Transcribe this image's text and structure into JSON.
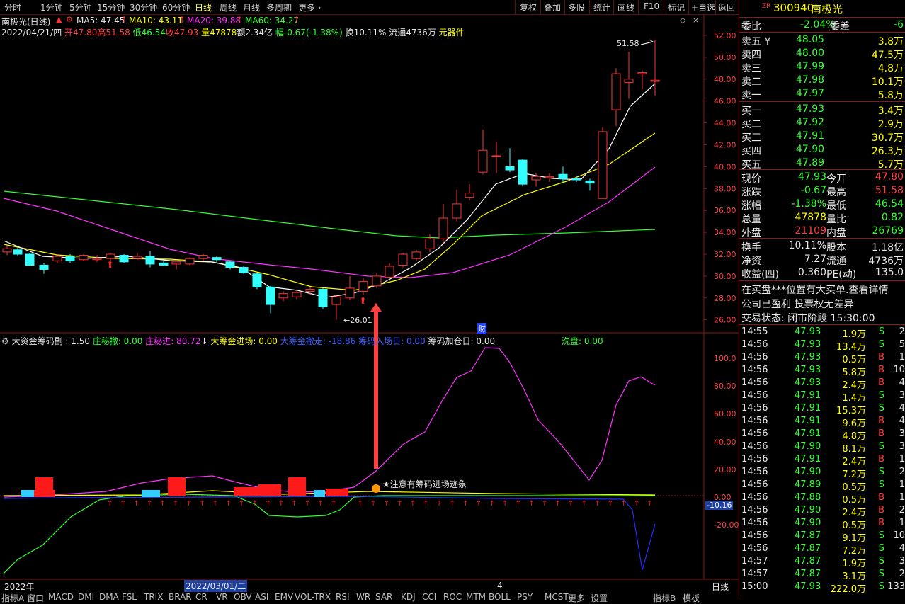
{
  "toolbar": {
    "periods": [
      "分时",
      "1分钟",
      "5分钟",
      "15分钟",
      "30分钟",
      "60分钟",
      "日线",
      "周线",
      "月线",
      "多周期",
      "更多"
    ],
    "active_period": "日线",
    "right_buttons": [
      "复权",
      "叠加",
      "多股",
      "统计",
      "画线",
      "F10",
      "标记",
      "+自选",
      "返回"
    ]
  },
  "indicator_line": {
    "name": "南极光(日线)",
    "ma5": "MA5: 47.45",
    "ma10": "MA10: 43.11",
    "ma20": "MA20: 39.88",
    "ma60": "MA60: 34.27"
  },
  "ohlc_line": {
    "date": "2022/04/21/四",
    "open": "开47.80",
    "high": "高51.58",
    "low": "低46.54",
    "close": "收47.93",
    "volume": "量47878",
    "amount": "额2.34亿",
    "change": "幅-0.67(-1.38%)",
    "turnover": "换10.11%",
    "float": "流通4736万",
    "sector": "元器件"
  },
  "price_axis": [
    "52.00",
    "50.00",
    "48.00",
    "46.00",
    "44.00",
    "42.00",
    "40.00",
    "38.00",
    "36.00",
    "34.00",
    "32.00",
    "30.00",
    "28.00",
    "26.00"
  ],
  "price_annotations": {
    "high": "51.58",
    "low": "26.01",
    "cai": "财"
  },
  "sub_indicator": {
    "name": "大资金筹码副 : 1.50",
    "zhuang_chesan": "庄秘撤: 0.00",
    "zhuang_jin": "庄秘进: 80.72",
    "big_in": "大筹金进场: 0.00",
    "big_out": "大筹金撤走: -18.86",
    "chip_day": "筹码入场日: 0.00",
    "chip_add": "筹码加仓日: 0.00",
    "wash": "洗盘: 0.00"
  },
  "sub_axis": [
    "100.0",
    "80.00",
    "60.00",
    "40.00",
    "20.00",
    "0.00",
    "-20.00"
  ],
  "sub_current": "-10.16",
  "annotation": "注意有筹码进场迹象",
  "x_axis": {
    "left": "2022年",
    "mid": "2022/03/01/二",
    "right": "4",
    "mode": "日线"
  },
  "bottom_tabs": [
    "指标A",
    "窗口",
    "MACD",
    "DMI",
    "DMA",
    "FSL",
    "TRIX",
    "BRAR",
    "CR",
    "VR",
    "OBV",
    "ASI",
    "EMV",
    "VOL-TRX",
    "RSI",
    "WR",
    "SAR",
    "KDJ",
    "CCI",
    "ROC",
    "MTM",
    "BOLL",
    "PSY",
    "MCST",
    "更多",
    "设置"
  ],
  "bottom_right": [
    "指标B",
    "模板"
  ],
  "quote": {
    "code": "300940",
    "name": "南极光",
    "badge": "ZR",
    "weibi_label": "委比",
    "weibi": "-2.04%",
    "weicha_label": "委差",
    "weicha": "-6",
    "asks": [
      {
        "label": "卖五",
        "mark": "¥",
        "price": "48.05",
        "vol": "3.8万"
      },
      {
        "label": "卖四",
        "mark": "",
        "price": "48.00",
        "vol": "47.5万"
      },
      {
        "label": "卖三",
        "mark": "",
        "price": "47.99",
        "vol": "4.8万"
      },
      {
        "label": "卖二",
        "mark": "",
        "price": "47.98",
        "vol": "10.1万"
      },
      {
        "label": "卖一",
        "mark": "",
        "price": "47.97",
        "vol": "5.8万"
      }
    ],
    "bids": [
      {
        "label": "买一",
        "price": "47.93",
        "vol": "3.4万"
      },
      {
        "label": "买二",
        "price": "47.92",
        "vol": "2.9万"
      },
      {
        "label": "买三",
        "price": "47.91",
        "vol": "30.7万"
      },
      {
        "label": "买四",
        "price": "47.90",
        "vol": "26.3万"
      },
      {
        "label": "买五",
        "price": "47.89",
        "vol": "5.7万"
      }
    ],
    "stats": [
      {
        "l1": "现价",
        "v1": "47.93",
        "l2": "今开",
        "v2": "47.80",
        "c1": "green",
        "c2": "red"
      },
      {
        "l1": "涨跌",
        "v1": "-0.67",
        "l2": "最高",
        "v2": "51.58",
        "c1": "green",
        "c2": "red"
      },
      {
        "l1": "涨幅",
        "v1": "-1.38%",
        "l2": "最低",
        "v2": "46.54",
        "c1": "green",
        "c2": "green"
      },
      {
        "l1": "总量",
        "v1": "47878",
        "l2": "量比",
        "v2": "0.82",
        "c1": "yellow",
        "c2": "green"
      },
      {
        "l1": "外盘",
        "v1": "21109",
        "l2": "内盘",
        "v2": "26769",
        "c1": "red",
        "c2": "green"
      }
    ],
    "fundamentals": [
      {
        "l1": "换手",
        "v1": "10.11%",
        "l2": "股本",
        "v2": "1.18亿"
      },
      {
        "l1": "净资",
        "v1": "7.27",
        "l2": "流通",
        "v2": "4736万"
      },
      {
        "l1": "收益(四)",
        "v1": "0.360",
        "l2": "PE(动)",
        "v2": "135.0"
      }
    ],
    "notes": [
      "在买盘***位置有大买单.查看详情",
      "公司已盈利 投票权无差异",
      "交易状态: 闭市阶段 15:30:00"
    ],
    "ticks": [
      {
        "t": "14:55",
        "p": "47.93",
        "v": "1.9万",
        "s": "S",
        "n": "2"
      },
      {
        "t": "14:56",
        "p": "47.93",
        "v": "13.4万",
        "s": "S",
        "n": "5"
      },
      {
        "t": "14:56",
        "p": "47.93",
        "v": "0.5万",
        "s": "B",
        "n": "1"
      },
      {
        "t": "14:56",
        "p": "47.93",
        "v": "5.8万",
        "s": "B",
        "n": "10"
      },
      {
        "t": "14:56",
        "p": "47.93",
        "v": "2.4万",
        "s": "B",
        "n": "4"
      },
      {
        "t": "14:56",
        "p": "47.91",
        "v": "1.4万",
        "s": "S",
        "n": "3"
      },
      {
        "t": "14:56",
        "p": "47.91",
        "v": "15.3万",
        "s": "S",
        "n": "4"
      },
      {
        "t": "14:56",
        "p": "47.91",
        "v": "9.6万",
        "s": "B",
        "n": "4"
      },
      {
        "t": "14:56",
        "p": "47.91",
        "v": "4.8万",
        "s": "B",
        "n": "3"
      },
      {
        "t": "14:56",
        "p": "47.90",
        "v": "8.1万",
        "s": "S",
        "n": "3"
      },
      {
        "t": "14:56",
        "p": "47.91",
        "v": "2.4万",
        "s": "B",
        "n": "1"
      },
      {
        "t": "14:56",
        "p": "47.90",
        "v": "7.2万",
        "s": "S",
        "n": "2"
      },
      {
        "t": "14:56",
        "p": "47.89",
        "v": "0.5万",
        "s": "S",
        "n": "1"
      },
      {
        "t": "14:56",
        "p": "47.88",
        "v": "0.5万",
        "s": "B",
        "n": "1"
      },
      {
        "t": "14:56",
        "p": "47.90",
        "v": "2.4万",
        "s": "B",
        "n": "2"
      },
      {
        "t": "14:56",
        "p": "47.90",
        "v": "0.5万",
        "s": "B",
        "n": "1"
      },
      {
        "t": "14:56",
        "p": "47.87",
        "v": "9.1万",
        "s": "S",
        "n": "10"
      },
      {
        "t": "14:56",
        "p": "47.87",
        "v": "7.2万",
        "s": "S",
        "n": "4"
      },
      {
        "t": "14:57",
        "p": "47.87",
        "v": "1.9万",
        "s": "S",
        "n": "3"
      },
      {
        "t": "14:57",
        "p": "47.87",
        "v": "3.1万",
        "s": "S",
        "n": "2"
      },
      {
        "t": "15:00",
        "p": "47.93",
        "v": "222.0万",
        "s": "S",
        "n": "133"
      }
    ]
  },
  "colors": {
    "up": "#ff3333",
    "down": "#33ffff",
    "ma5": "#ffffff",
    "ma10": "#ffff00",
    "ma20": "#ff33ff",
    "ma60": "#33ff33",
    "grid": "#8a1a1a"
  }
}
